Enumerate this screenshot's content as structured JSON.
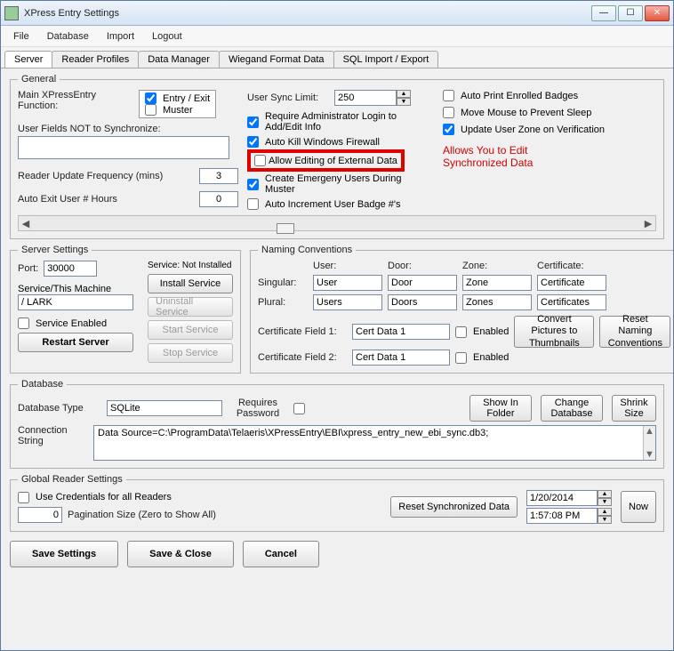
{
  "window": {
    "title": "XPress Entry Settings"
  },
  "menu": {
    "file": "File",
    "database": "Database",
    "import": "Import",
    "logout": "Logout"
  },
  "tabs": {
    "server": "Server",
    "reader_profiles": "Reader Profiles",
    "data_manager": "Data Manager",
    "wiegand": "Wiegand Format Data",
    "sql_import": "SQL Import / Export"
  },
  "general": {
    "legend": "General",
    "main_func_label": "Main XPressEntry Function:",
    "entry_exit": "Entry / Exit",
    "muster": "Muster",
    "user_fields_not_sync": "User Fields NOT to Synchronize:",
    "user_fields_value": "",
    "reader_update_freq": "Reader Update Frequency (mins)",
    "reader_update_value": "3",
    "auto_exit_hours": "Auto Exit User # Hours",
    "auto_exit_value": "0",
    "user_sync_limit": "User Sync Limit:",
    "user_sync_value": "250",
    "require_admin": "Require Administrator Login to Add/Edit Info",
    "auto_kill_fw": "Auto Kill Windows Firewall",
    "allow_edit_ext": "Allow Editing of External Data",
    "create_emergency": "Create Emergeny Users During Muster",
    "auto_inc_badge": "Auto Increment User Badge #'s",
    "auto_print": "Auto Print Enrolled Badges",
    "move_mouse": "Move Mouse to Prevent Sleep",
    "update_zone": "Update User Zone on Verification",
    "red_note1": "Allows You to Edit",
    "red_note2": "Synchronized Data"
  },
  "server_settings": {
    "legend": "Server Settings",
    "port_label": "Port:",
    "port_value": "30000",
    "service_label": "Service/This Machine",
    "service_value": "/ LARK",
    "service_enabled": "Service Enabled",
    "service_status": "Service: Not Installed",
    "install": "Install Service",
    "uninstall": "Uninstall Service",
    "start": "Start Service",
    "stop": "Stop Service",
    "restart": "Restart Server"
  },
  "naming": {
    "legend": "Naming Conventions",
    "user": "User:",
    "door": "Door:",
    "zone": "Zone:",
    "cert": "Certificate:",
    "singular": "Singular:",
    "plural": "Plural:",
    "user_s": "User",
    "door_s": "Door",
    "zone_s": "Zone",
    "cert_s": "Certificate",
    "user_p": "Users",
    "door_p": "Doors",
    "zone_p": "Zones",
    "cert_p": "Certificates",
    "cf1": "Certificate Field 1:",
    "cf1_v": "Cert Data 1",
    "cf2": "Certificate Field 2:",
    "cf2_v": "Cert Data 1",
    "enabled": "Enabled",
    "convert": "Convert Pictures to Thumbnails",
    "reset": "Reset Naming Conventions"
  },
  "database": {
    "legend": "Database",
    "type_label": "Database Type",
    "type_value": "SQLite",
    "req_pwd": "Requires Password",
    "show_folder": "Show In Folder",
    "change_db": "Change Database",
    "shrink": "Shrink Size",
    "conn_label": "Connection String",
    "conn_value": "Data Source=C:\\ProgramData\\Telaeris\\XPressEntry\\EBI\\xpress_entry_new_ebi_sync.db3;"
  },
  "global_reader": {
    "legend": "Global Reader Settings",
    "use_creds": "Use Credentials for all Readers",
    "pagination_label": "Pagination Size (Zero to Show All)",
    "pagination_value": "0",
    "reset_sync": "Reset Synchronized Data",
    "date": "1/20/2014",
    "time": "1:57:08 PM",
    "now": "Now"
  },
  "footer": {
    "save": "Save Settings",
    "save_close": "Save & Close",
    "cancel": "Cancel"
  }
}
